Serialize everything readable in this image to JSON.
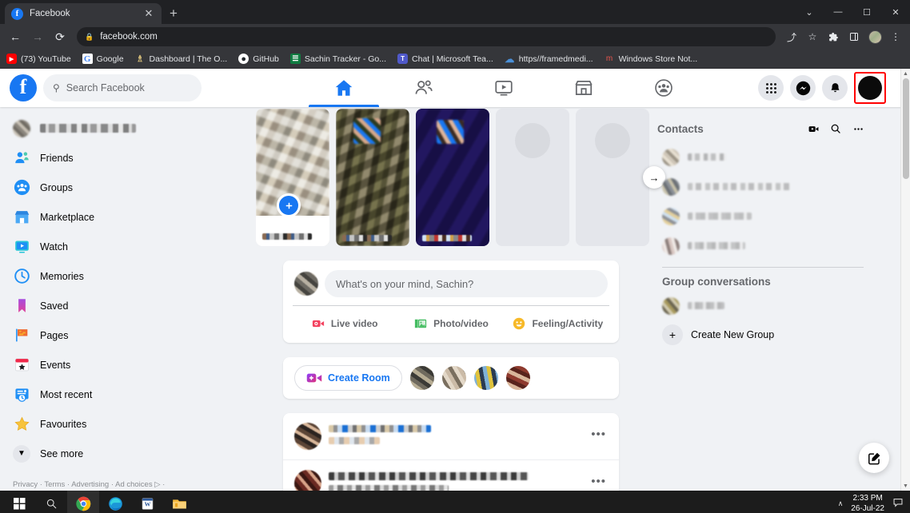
{
  "browser": {
    "tab": {
      "title": "Facebook",
      "favicon": "facebook-icon",
      "close_label": "✕"
    },
    "new_tab_label": "+",
    "window_controls": {
      "more": "⌄",
      "minimize": "—",
      "maximize": "☐",
      "close": "✕"
    },
    "nav": {
      "back": "←",
      "forward": "→",
      "reload": "⟳"
    },
    "omnibox": {
      "lock": "🔒",
      "url": "facebook.com"
    },
    "toolbar_icons": {
      "share": "⤴",
      "bookmark": "☆",
      "extensions": "🧩",
      "sidepanel": "▣",
      "profile": "profile-avatar",
      "menu": "⋮"
    },
    "bookmarks": [
      {
        "label": "(73) YouTube",
        "icon": "youtube-icon",
        "glyph": "▶"
      },
      {
        "label": "Google",
        "icon": "google-icon",
        "glyph": "G"
      },
      {
        "label": "Dashboard | The O...",
        "icon": "dashboard-icon",
        "glyph": "♕"
      },
      {
        "label": "GitHub",
        "icon": "github-icon",
        "glyph": "●"
      },
      {
        "label": "Sachin Tracker - Go...",
        "icon": "sheets-icon",
        "glyph": "☰"
      },
      {
        "label": "Chat | Microsoft Tea...",
        "icon": "teams-icon",
        "glyph": "T"
      },
      {
        "label": "https//framedmedi...",
        "icon": "cloud-icon",
        "glyph": "☁"
      },
      {
        "label": "Windows Store Not...",
        "icon": "m-icon",
        "glyph": "m"
      }
    ]
  },
  "facebook": {
    "logo": "f",
    "search": {
      "placeholder": "Search Facebook",
      "icon": "search-icon"
    },
    "nav_tabs": [
      {
        "name": "home",
        "icon": "home-icon",
        "active": true
      },
      {
        "name": "friends",
        "icon": "friends-icon",
        "active": false
      },
      {
        "name": "watch",
        "icon": "watch-icon",
        "active": false
      },
      {
        "name": "marketplace",
        "icon": "marketplace-icon",
        "active": false
      },
      {
        "name": "groups",
        "icon": "groups-icon",
        "active": false
      }
    ],
    "header_actions": [
      {
        "name": "menu-grid",
        "icon": "grid-icon"
      },
      {
        "name": "messenger",
        "icon": "messenger-icon"
      },
      {
        "name": "notifications",
        "icon": "bell-icon"
      }
    ],
    "account_highlight_color": "#ff0000",
    "sidebar": {
      "profile_name": "",
      "items": [
        {
          "label": "Friends",
          "icon": "friends-icon"
        },
        {
          "label": "Groups",
          "icon": "groups-icon"
        },
        {
          "label": "Marketplace",
          "icon": "marketplace-icon"
        },
        {
          "label": "Watch",
          "icon": "watch-icon"
        },
        {
          "label": "Memories",
          "icon": "clock-icon"
        },
        {
          "label": "Saved",
          "icon": "bookmark-icon"
        },
        {
          "label": "Pages",
          "icon": "flag-icon"
        },
        {
          "label": "Events",
          "icon": "calendar-icon"
        },
        {
          "label": "Most recent",
          "icon": "recent-icon"
        },
        {
          "label": "Favourites",
          "icon": "star-icon"
        },
        {
          "label": "See more",
          "icon": "chevron-down-icon"
        }
      ],
      "legal": "Privacy · Terms · Advertising · Ad choices"
    },
    "stories": {
      "next_label": "→",
      "items": [
        {
          "name": "create-story",
          "type": "create"
        },
        {
          "name": "story-1",
          "type": "photo"
        },
        {
          "name": "story-2",
          "type": "photo"
        },
        {
          "name": "story-placeholder-1",
          "type": "placeholder"
        },
        {
          "name": "story-placeholder-2",
          "type": "placeholder"
        }
      ]
    },
    "composer": {
      "placeholder": "What's on your mind, Sachin?",
      "actions": [
        {
          "label": "Live video",
          "icon": "video-camera-icon",
          "color": "#f3425f"
        },
        {
          "label": "Photo/video",
          "icon": "photo-icon",
          "color": "#45bd62"
        },
        {
          "label": "Feeling/Activity",
          "icon": "smiley-icon",
          "color": "#f7b928"
        }
      ]
    },
    "room": {
      "button_label": "Create Room",
      "icon": "video-plus-icon",
      "avatar_count": 4
    },
    "posts": [
      {
        "name": "post-1",
        "more_label": "•••"
      },
      {
        "name": "post-2",
        "more_label": "•••"
      }
    ],
    "contacts": {
      "title": "Contacts",
      "actions": [
        {
          "name": "new-video-room",
          "icon": "video-icon",
          "glyph": "▶"
        },
        {
          "name": "search-contacts",
          "icon": "search-icon",
          "glyph": "⚲"
        },
        {
          "name": "contacts-options",
          "icon": "ellipsis-icon",
          "glyph": "•••"
        }
      ],
      "items": [
        {
          "name": "contact-1"
        },
        {
          "name": "contact-2"
        },
        {
          "name": "contact-3"
        },
        {
          "name": "contact-4"
        }
      ]
    },
    "group_conversations": {
      "title": "Group conversations",
      "items": [
        {
          "name": "group-1"
        }
      ],
      "create_label": "Create New Group",
      "create_icon": "plus-icon"
    },
    "fab": {
      "name": "new-message-fab",
      "icon": "compose-icon"
    }
  },
  "scrollbar": {
    "up": "▲",
    "down": "▼"
  },
  "taskbar": {
    "items": [
      {
        "name": "start-button",
        "icon": "windows-icon"
      },
      {
        "name": "search-button",
        "icon": "search-icon"
      },
      {
        "name": "chrome-button",
        "icon": "chrome-icon",
        "active": true
      },
      {
        "name": "edge-button",
        "icon": "edge-icon",
        "active": false
      },
      {
        "name": "word-button",
        "icon": "word-icon",
        "active": false
      },
      {
        "name": "explorer-button",
        "icon": "folder-icon",
        "active": false
      }
    ],
    "tray": {
      "chevron": "∧",
      "time": "2:33 PM",
      "date": "26-Jul-22",
      "notification_icon": "notification-icon"
    }
  }
}
